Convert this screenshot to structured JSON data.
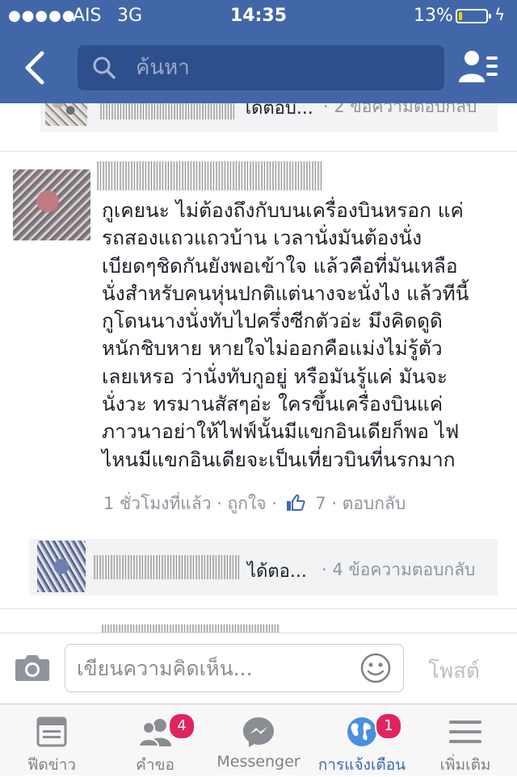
{
  "status_bar": {
    "signal": "●●●●●",
    "carrier": "AIS",
    "network": "3G",
    "time": "14:35",
    "battery_percent": "13%",
    "battery_level": 0.13
  },
  "nav": {
    "search_placeholder": "ค้นหา"
  },
  "replies_top": {
    "label": "ได้ตอบ...",
    "count": "· 2 ข้อความตอบกลับ"
  },
  "comment": {
    "lines": [
      "กูเคยนะ ไม่ต้องถึงกับบนเครื่องบินหรอก แค่",
      "รถสองแถวแถวบ้าน เวลานั่งมันต้องนั่ง",
      "เบียดๆชิดกันยังพอเข้าใจ แล้วคือที่มันเหลือ",
      "นั่งสำหรับคนหุ่นปกติแต่นางจะนั่งไง แล้วทีนี้",
      "กูโดนนางนั่งทับไปครึ่งซีกตัวอ่ะ มึงคิดดูดิ",
      "หนักชิบหาย หายใจไม่ออกคือแม่งไม่รู้ตัว",
      "เลยเหรอ ว่านั่งทับกูอยู่ หรือมันรู้แค่ มันจะ",
      "นั่งวะ ทรมานสัสๆอ่ะ ใครขึ้นเครื่องบินแค่",
      "ภาวนาอย่าให้ไฟฟ์นั้นมีแขกอินเดียก็พอ ไฟ",
      "ไหนมีแขกอินเดียจะเป็นเที่ยวบินที่นรกมาก"
    ],
    "time_ago": "1 ชั่วโมงที่แล้ว",
    "like_label": "· ถูกใจ ·",
    "like_count": "7",
    "reply_label": "· ตอบกลับ"
  },
  "replies_bottom": {
    "label": "ได้ตอ...",
    "count": "· 4 ข้อความตอบกลับ"
  },
  "composer": {
    "placeholder": "เขียนความคิดเห็น...",
    "post_label": "โพสต์"
  },
  "tabs": [
    {
      "label": "ฟีดข่าว",
      "icon": "news-feed-icon",
      "badge": ""
    },
    {
      "label": "คำขอ",
      "icon": "friend-requests-icon",
      "badge": "4"
    },
    {
      "label": "Messenger",
      "icon": "messenger-icon",
      "badge": ""
    },
    {
      "label": "การแจ้งเตือน",
      "icon": "notifications-globe-icon",
      "badge": "1",
      "active": true
    },
    {
      "label": "เพิ่มเติม",
      "icon": "menu-icon",
      "badge": ""
    }
  ],
  "colors": {
    "brand_blue": "#4267a8",
    "badge_red": "#e0245e",
    "meta_gray": "#90949c"
  }
}
